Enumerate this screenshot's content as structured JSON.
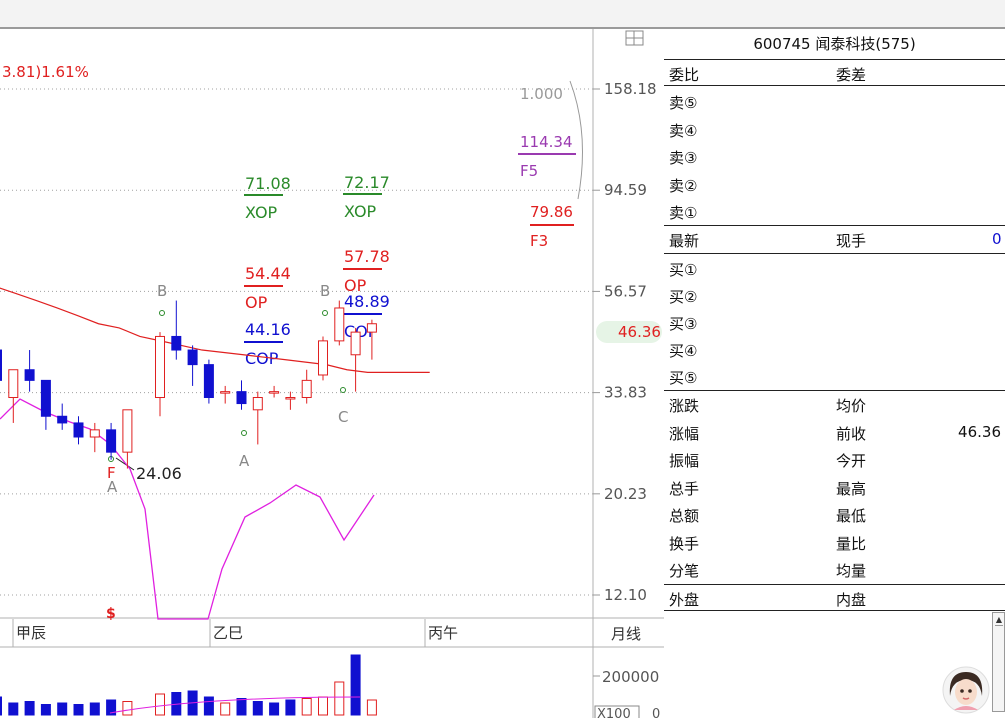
{
  "header_change": "3.81)1.61%",
  "price_axis": {
    "labels": [
      "158.18",
      "94.59",
      "56.57",
      "33.83",
      "20.23",
      "12.10"
    ],
    "current": "46.36"
  },
  "layout_icon": "grid-icon",
  "fib_bracket": {
    "top": "1.000",
    "f5_value": "114.34",
    "f5_label": "F5",
    "f3_value": "79.86",
    "f3_label": "F3"
  },
  "annotations": {
    "xop1": "71.08",
    "xop_label": "XOP",
    "xop2": "72.17",
    "op1": "54.44",
    "op_label": "OP",
    "op2": "57.78",
    "cop1": "44.16",
    "cop_label": "COP",
    "cop2": "48.89",
    "b_label": "B",
    "a_label": "A",
    "c_label": "C",
    "f_label": "F",
    "low_value": "24.06",
    "s_mark": "$"
  },
  "time_axis": {
    "labels": [
      "甲辰",
      "乙巳",
      "丙午"
    ],
    "period_button": "月线"
  },
  "volume_axis": {
    "label": "200000",
    "unit": "X100",
    "zero": "0"
  },
  "quote": {
    "title": "600745 闻泰科技(575)",
    "row_weibi": {
      "label": "委比",
      "label2": "委差"
    },
    "sell_rows": [
      "卖⑤",
      "卖④",
      "卖③",
      "卖②",
      "卖①"
    ],
    "latest": {
      "label": "最新",
      "label2": "现手",
      "value2": "0"
    },
    "buy_rows": [
      "买①",
      "买②",
      "买③",
      "买④",
      "买⑤"
    ],
    "stats": [
      {
        "l1": "涨跌",
        "l2": "均价",
        "v2": ""
      },
      {
        "l1": "涨幅",
        "l2": "前收",
        "v2": "46.36"
      },
      {
        "l1": "振幅",
        "l2": "今开",
        "v2": ""
      },
      {
        "l1": "总手",
        "l2": "最高",
        "v2": ""
      },
      {
        "l1": "总额",
        "l2": "最低",
        "v2": ""
      },
      {
        "l1": "换手",
        "l2": "量比",
        "v2": ""
      },
      {
        "l1": "分笔",
        "l2": "均量",
        "v2": ""
      }
    ],
    "outer": {
      "label": "外盘",
      "label2": "内盘"
    }
  },
  "colors": {
    "up": "#e02020",
    "down": "#1010d0",
    "ma": "#e02020",
    "pink": "#e020e0",
    "green": "#2a8a2a",
    "purple": "#9a3ab0"
  },
  "candles": [
    {
      "o": 42,
      "h": 50,
      "l": 34,
      "c": 36
    },
    {
      "o": 33,
      "h": 38,
      "l": 29,
      "c": 38
    },
    {
      "o": 38,
      "h": 42,
      "l": 34,
      "c": 36
    },
    {
      "o": 36,
      "h": 36,
      "l": 28,
      "c": 30
    },
    {
      "o": 30,
      "h": 32,
      "l": 28,
      "c": 29
    },
    {
      "o": 29,
      "h": 30,
      "l": 26,
      "c": 27
    },
    {
      "o": 27,
      "h": 29,
      "l": 25,
      "c": 28
    },
    {
      "o": 28,
      "h": 29,
      "l": 24.06,
      "c": 25
    },
    {
      "o": 25,
      "h": 31,
      "l": 23,
      "c": 31
    },
    {
      "o": null
    },
    {
      "o": 33,
      "h": 46,
      "l": 30,
      "c": 45
    },
    {
      "o": 45,
      "h": 54,
      "l": 40,
      "c": 42
    },
    {
      "o": 42,
      "h": 43,
      "l": 35,
      "c": 39
    },
    {
      "o": 39,
      "h": 40,
      "l": 32,
      "c": 33
    },
    {
      "o": 34,
      "h": 35,
      "l": 32,
      "c": 34
    },
    {
      "o": 34,
      "h": 36,
      "l": 31,
      "c": 32
    },
    {
      "o": 31,
      "h": 34,
      "l": 26,
      "c": 33
    },
    {
      "o": 34,
      "h": 35,
      "l": 33,
      "c": 34
    },
    {
      "o": 33,
      "h": 34,
      "l": 31,
      "c": 33
    },
    {
      "o": 33,
      "h": 38,
      "l": 32,
      "c": 36
    },
    {
      "o": 37,
      "h": 45,
      "l": 36,
      "c": 44
    },
    {
      "o": 44,
      "h": 54,
      "l": 43,
      "c": 52
    },
    {
      "o": 41,
      "h": 47,
      "l": 34,
      "c": 46
    },
    {
      "o": 46,
      "h": 49,
      "l": 40,
      "c": 48
    }
  ],
  "ma_line": [
    58,
    56,
    54,
    52,
    50,
    48,
    47,
    45,
    44,
    43,
    42,
    41.5,
    41,
    40.5,
    40,
    39.5,
    39,
    38,
    37.5,
    37.5,
    37.5,
    37.5
  ],
  "pink_line": [
    34,
    29,
    28,
    27,
    26,
    25,
    20,
    14,
    10,
    10,
    14,
    20,
    24,
    26,
    27,
    27,
    24,
    24,
    26,
    28
  ],
  "volume": [
    {
      "v": 60,
      "up": false
    },
    {
      "v": 40,
      "up": false
    },
    {
      "v": 45,
      "up": false
    },
    {
      "v": 35,
      "up": false
    },
    {
      "v": 40,
      "up": false
    },
    {
      "v": 35,
      "up": false
    },
    {
      "v": 40,
      "up": false
    },
    {
      "v": 50,
      "up": false
    },
    {
      "v": 45,
      "up": true
    },
    {
      "v": 0,
      "up": true
    },
    {
      "v": 70,
      "up": true
    },
    {
      "v": 75,
      "up": false
    },
    {
      "v": 80,
      "up": false
    },
    {
      "v": 60,
      "up": false
    },
    {
      "v": 40,
      "up": true
    },
    {
      "v": 55,
      "up": false
    },
    {
      "v": 45,
      "up": false
    },
    {
      "v": 40,
      "up": false
    },
    {
      "v": 50,
      "up": false
    },
    {
      "v": 55,
      "up": true
    },
    {
      "v": 60,
      "up": true
    },
    {
      "v": 110,
      "up": true
    },
    {
      "v": 200,
      "up": false
    },
    {
      "v": 50,
      "up": true
    }
  ]
}
